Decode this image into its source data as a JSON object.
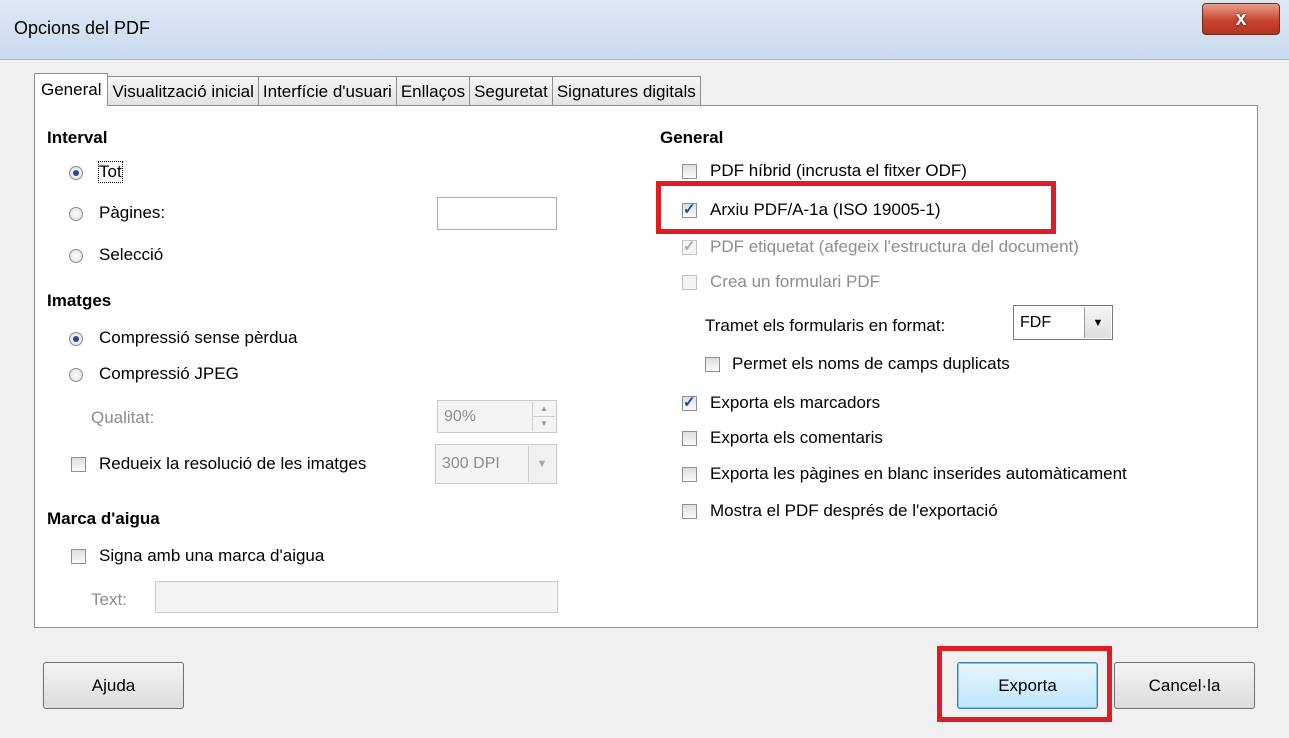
{
  "window": {
    "title": "Opcions del PDF",
    "close_glyph": "x"
  },
  "tabs": [
    "General",
    "Visualització inicial",
    "Interfície d'usuari",
    "Enllaços",
    "Seguretat",
    "Signatures digitals"
  ],
  "interval": {
    "heading": "Interval",
    "all": "Tot",
    "pages": "Pàgines:",
    "pages_value": "",
    "selection": "Selecció"
  },
  "images": {
    "heading": "Imatges",
    "lossless": "Compressió sense pèrdua",
    "jpeg": "Compressió JPEG",
    "quality_label": "Qualitat:",
    "quality_value": "90%",
    "reduce_label": "Redueix la resolució de les imatges",
    "dpi_value": "300 DPI"
  },
  "watermark": {
    "heading": "Marca d'aigua",
    "sign_label": "Signa amb una marca d'aigua",
    "text_label": "Text:",
    "text_value": ""
  },
  "general": {
    "heading": "General",
    "hybrid": "PDF híbrid (incrusta el fitxer ODF)",
    "archive": "Arxiu PDF/A-1a (ISO 19005-1)",
    "tagged": "PDF etiquetat (afegeix l'estructura del document)",
    "form": "Crea un formulari PDF",
    "submit_label": "Tramet els formularis en format:",
    "submit_value": "FDF",
    "duplicate": "Permet els noms de camps duplicats",
    "bookmarks": "Exporta els marcadors",
    "comments": "Exporta els comentaris",
    "blank_pages": "Exporta les pàgines en blanc inserides automàticament",
    "show_after": "Mostra el PDF després de l'exportació"
  },
  "buttons": {
    "help": "Ajuda",
    "export": "Exporta",
    "cancel": "Cancel·la"
  },
  "colors": {
    "highlight": "#e01b24",
    "accent": "#1d4e9c"
  }
}
